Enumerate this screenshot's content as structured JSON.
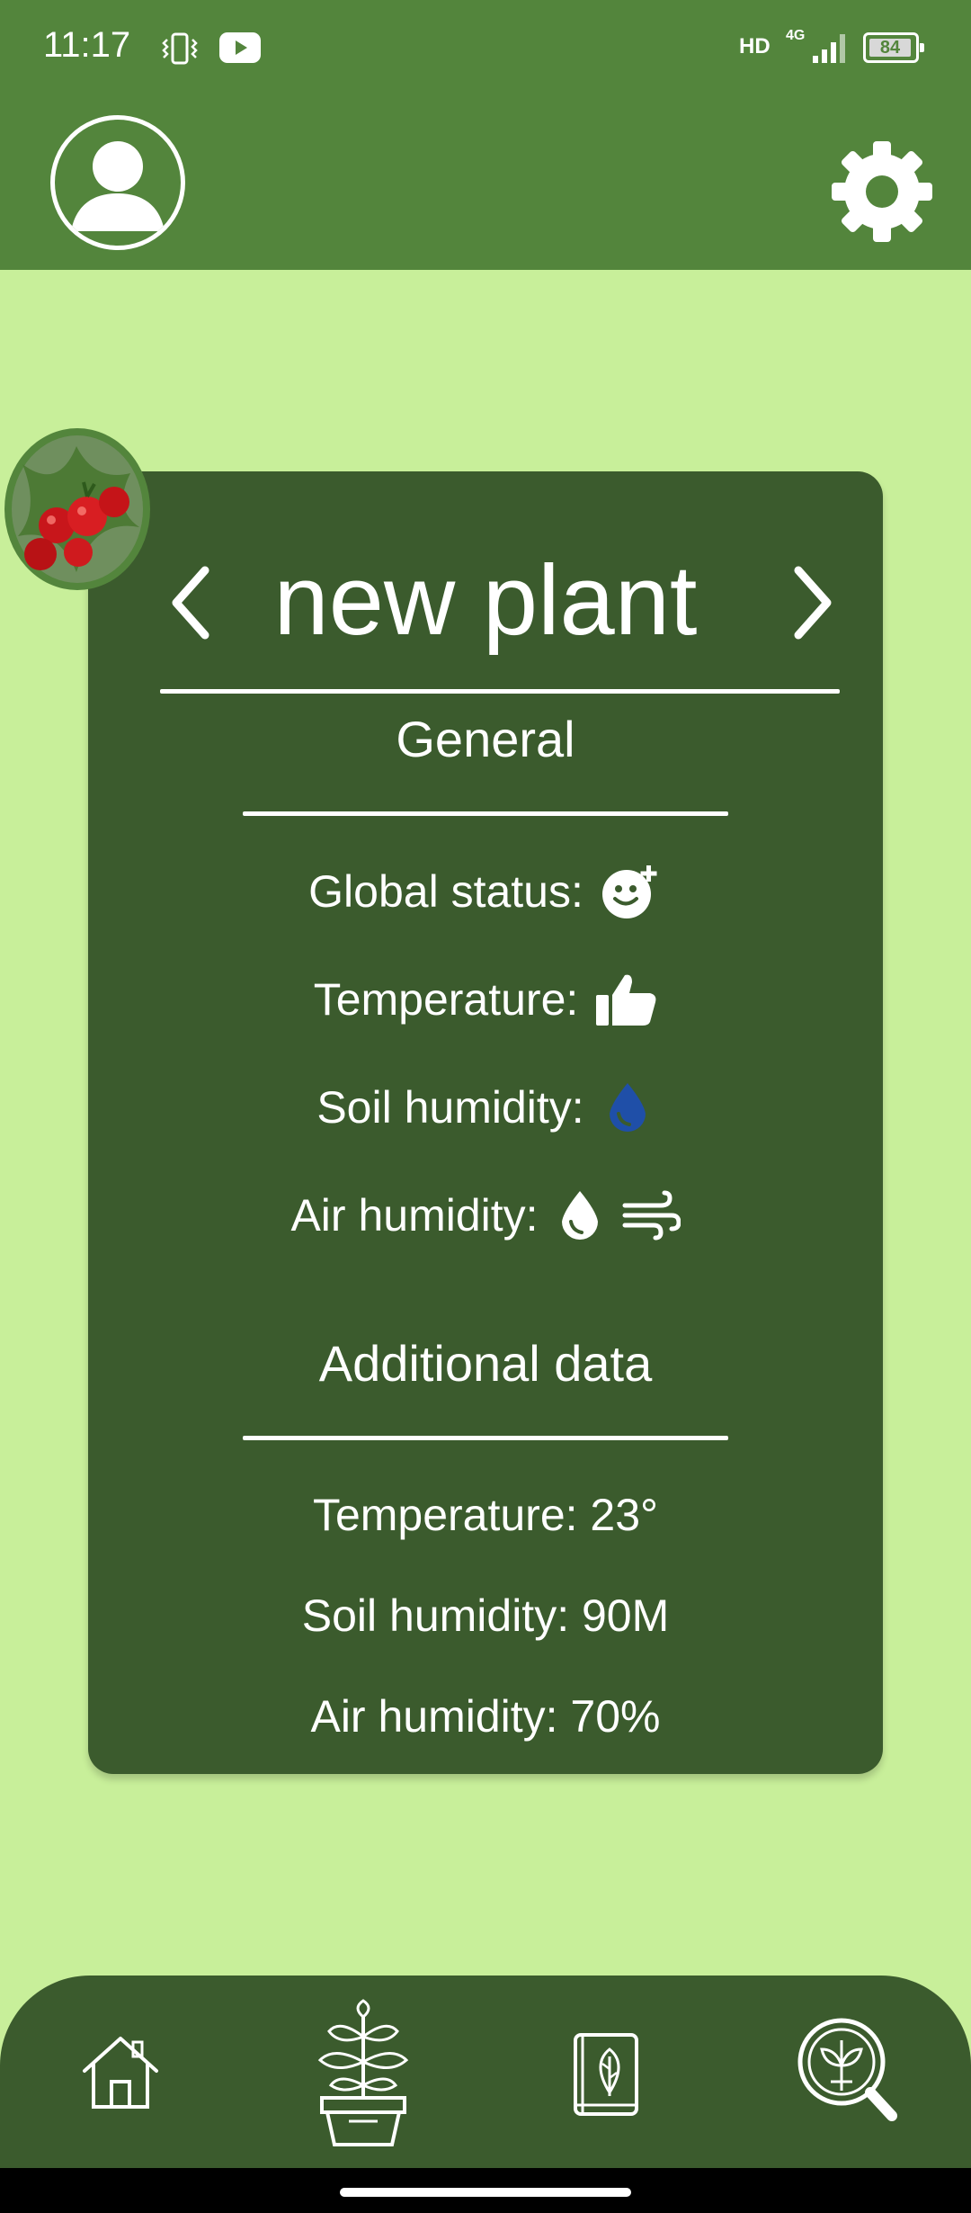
{
  "status_bar": {
    "time": "11:17",
    "network_hd": "HD",
    "network_type": "4G",
    "battery_level": "84",
    "icons": [
      "vibrate-icon",
      "youtube-icon",
      "signal-icon",
      "battery-icon"
    ]
  },
  "header": {
    "profile_icon": "user-avatar-icon",
    "settings_icon": "gear-icon"
  },
  "plant_card": {
    "plant_name": "new plant",
    "prev_icon": "chevron-left-icon",
    "next_icon": "chevron-right-icon",
    "general": {
      "title": "General",
      "global_status_label": "Global status:",
      "temperature_label": "Temperature:",
      "soil_humidity_label": "Soil humidity:",
      "air_humidity_label": "Air humidity:",
      "status_icons": {
        "global_status": "happy-face-plus-icon",
        "temperature": "thumbs-up-icon",
        "soil_humidity": "water-drop-icon",
        "air_humidity": [
          "water-drop-icon",
          "wind-icon"
        ]
      }
    },
    "additional": {
      "title": "Additional data",
      "temperature": "Temperature: 23°",
      "soil_humidity": "Soil humidity: 90M",
      "air_humidity": "Air humidity: 70%"
    }
  },
  "bottom_nav": {
    "items": [
      "home-icon",
      "potted-plant-icon",
      "plant-book-icon",
      "plant-search-icon"
    ]
  },
  "colors": {
    "app_background": "#c8ef9a",
    "header_green": "#53853c",
    "card_dark_green": "#3b5b2d",
    "soil_drop_blue": "#1f4fa8",
    "text_white": "#ffffff"
  }
}
